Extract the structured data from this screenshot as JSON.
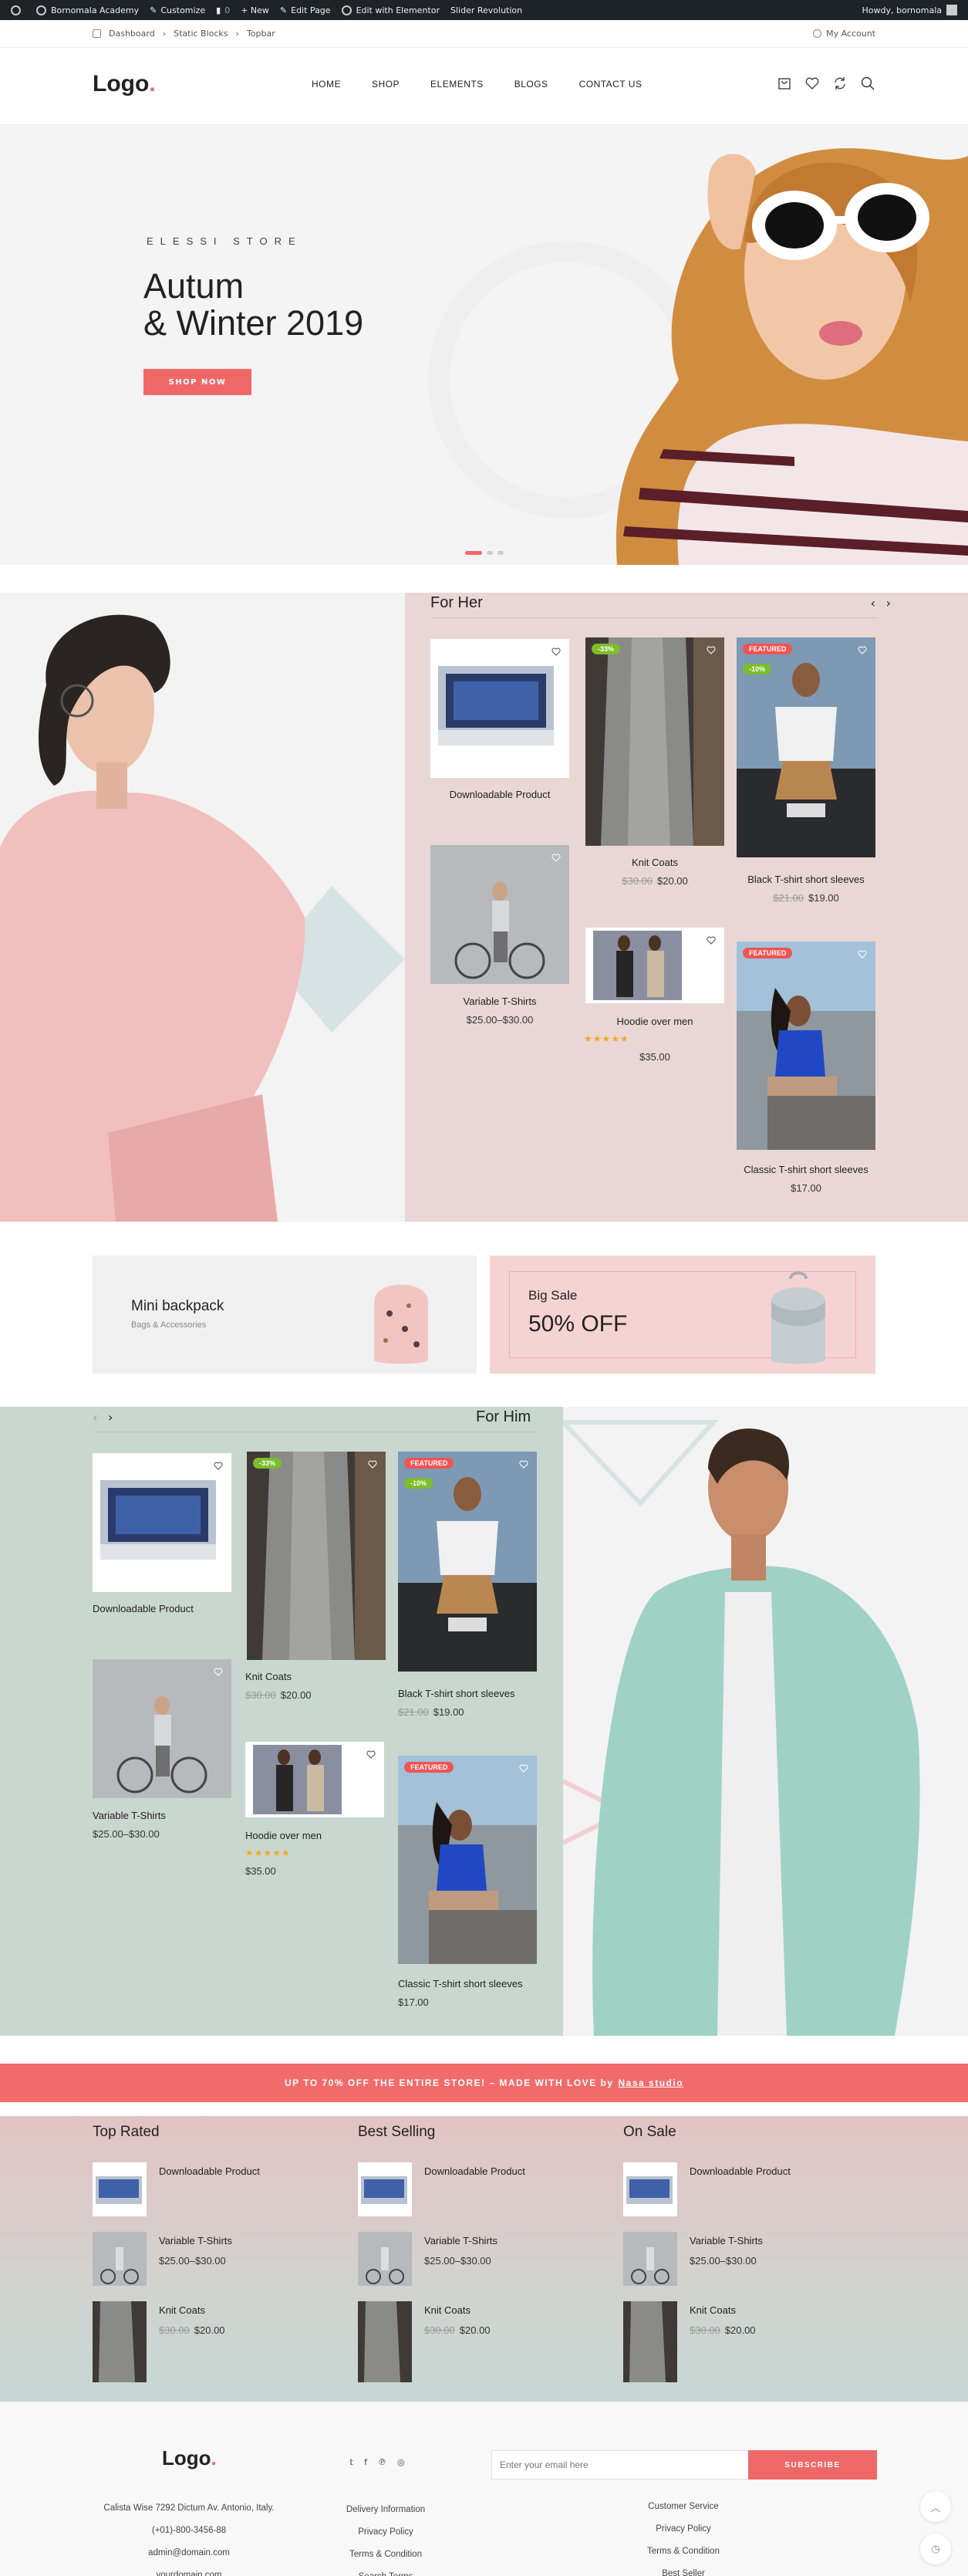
{
  "adminbar": {
    "site": "Bornomala Academy",
    "customize": "Customize",
    "comments": "0",
    "new": "+ New",
    "edit_page": "Edit Page",
    "edit_elementor": "Edit with Elementor",
    "slider": "Slider Revolution",
    "howdy": "Howdy, bornomala"
  },
  "topbar": {
    "crumbs": [
      "Dashboard",
      "Static Blocks",
      "Topbar"
    ],
    "account": "My Account"
  },
  "header": {
    "logo": "Logo",
    "logo_dot": ".",
    "nav": [
      "HOME",
      "SHOP",
      "ELEMENTS",
      "BLOGS",
      "CONTACT US"
    ],
    "icons": [
      "cart-icon",
      "heart-icon",
      "compare-icon",
      "search-icon"
    ]
  },
  "hero": {
    "subtitle": "ELESSI STORE",
    "title_line1": "Autum",
    "title_line2": "& Winter 2019",
    "button": "SHOP NOW",
    "slides": 3,
    "active_slide": 1
  },
  "her": {
    "title": "For Her",
    "products": [
      {
        "name": "Downloadable Product"
      },
      {
        "name": "Knit Coats",
        "old_price": "$30.00",
        "price": "$20.00",
        "badge": "-33%"
      },
      {
        "name": "Black T-shirt short sleeves",
        "old_price": "$21.00",
        "price": "$19.00",
        "badges": [
          "FEATURED",
          "-10%"
        ]
      },
      {
        "name": "Variable T-Shirts",
        "price": "$25.00–$30.00"
      },
      {
        "name": "Hoodie over men",
        "price": "$35.00",
        "rating": 5
      },
      {
        "name": "Classic T-shirt short sleeves",
        "price": "$17.00",
        "badge": "FEATURED"
      }
    ]
  },
  "banners": {
    "left_title": "Mini backpack",
    "left_sub": "Bags & Accessories",
    "right_title": "Big Sale",
    "right_big": "50% OFF"
  },
  "him": {
    "title": "For Him",
    "products": [
      {
        "name": "Downloadable Product"
      },
      {
        "name": "Knit Coats",
        "old_price": "$30.00",
        "price": "$20.00",
        "badge": "-33%"
      },
      {
        "name": "Black T-shirt short sleeves",
        "old_price": "$21.00",
        "price": "$19.00",
        "badges": [
          "FEATURED",
          "-10%"
        ]
      },
      {
        "name": "Variable T-Shirts",
        "price": "$25.00–$30.00"
      },
      {
        "name": "Hoodie over men",
        "price": "$35.00",
        "rating": 5
      },
      {
        "name": "Classic T-shirt short sleeves",
        "price": "$17.00",
        "badge": "FEATURED"
      }
    ]
  },
  "promo": {
    "text": "UP TO 70% OFF THE ENTIRE STORE! – MADE WITH LOVE by",
    "link": "Nasa studio"
  },
  "lists": [
    {
      "title": "Top Rated",
      "items": [
        {
          "name": "Downloadable Product",
          "price": ""
        },
        {
          "name": "Variable T-Shirts",
          "price": "$25.00–$30.00"
        },
        {
          "name": "Knit Coats",
          "old_price": "$30.00",
          "price": "$20.00"
        }
      ]
    },
    {
      "title": "Best Selling",
      "items": [
        {
          "name": "Downloadable Product",
          "price": ""
        },
        {
          "name": "Variable T-Shirts",
          "price": "$25.00–$30.00"
        },
        {
          "name": "Knit Coats",
          "old_price": "$30.00",
          "price": "$20.00"
        }
      ]
    },
    {
      "title": "On Sale",
      "items": [
        {
          "name": "Downloadable Product",
          "price": ""
        },
        {
          "name": "Variable T-Shirts",
          "price": "$25.00–$30.00"
        },
        {
          "name": "Knit Coats",
          "old_price": "$30.00",
          "price": "$20.00"
        }
      ]
    }
  ],
  "footer": {
    "logo": "Logo",
    "social": [
      "twitter-icon",
      "facebook-icon",
      "pinterest-icon",
      "instagram-icon"
    ],
    "email_placeholder": "Enter your email here",
    "subscribe": "SUBSCRIBE",
    "address": "Calista Wise 7292 Dictum Av. Antonio, Italy.",
    "phone": "(+01)-800-3456-88",
    "email": "admin@domain.com",
    "website": "yourdomain.com",
    "links_mid": [
      "Delivery Information",
      "Privacy Policy",
      "Terms & Condition",
      "Search Terms"
    ],
    "links_right": [
      "Customer Service",
      "Privacy Policy",
      "Terms & Condition",
      "Best Seller"
    ]
  },
  "colors": {
    "accent": "#ef6868",
    "her_bg": "#e9d7d6",
    "him_bg": "#c9d7d1",
    "dark": "#1d2327"
  }
}
